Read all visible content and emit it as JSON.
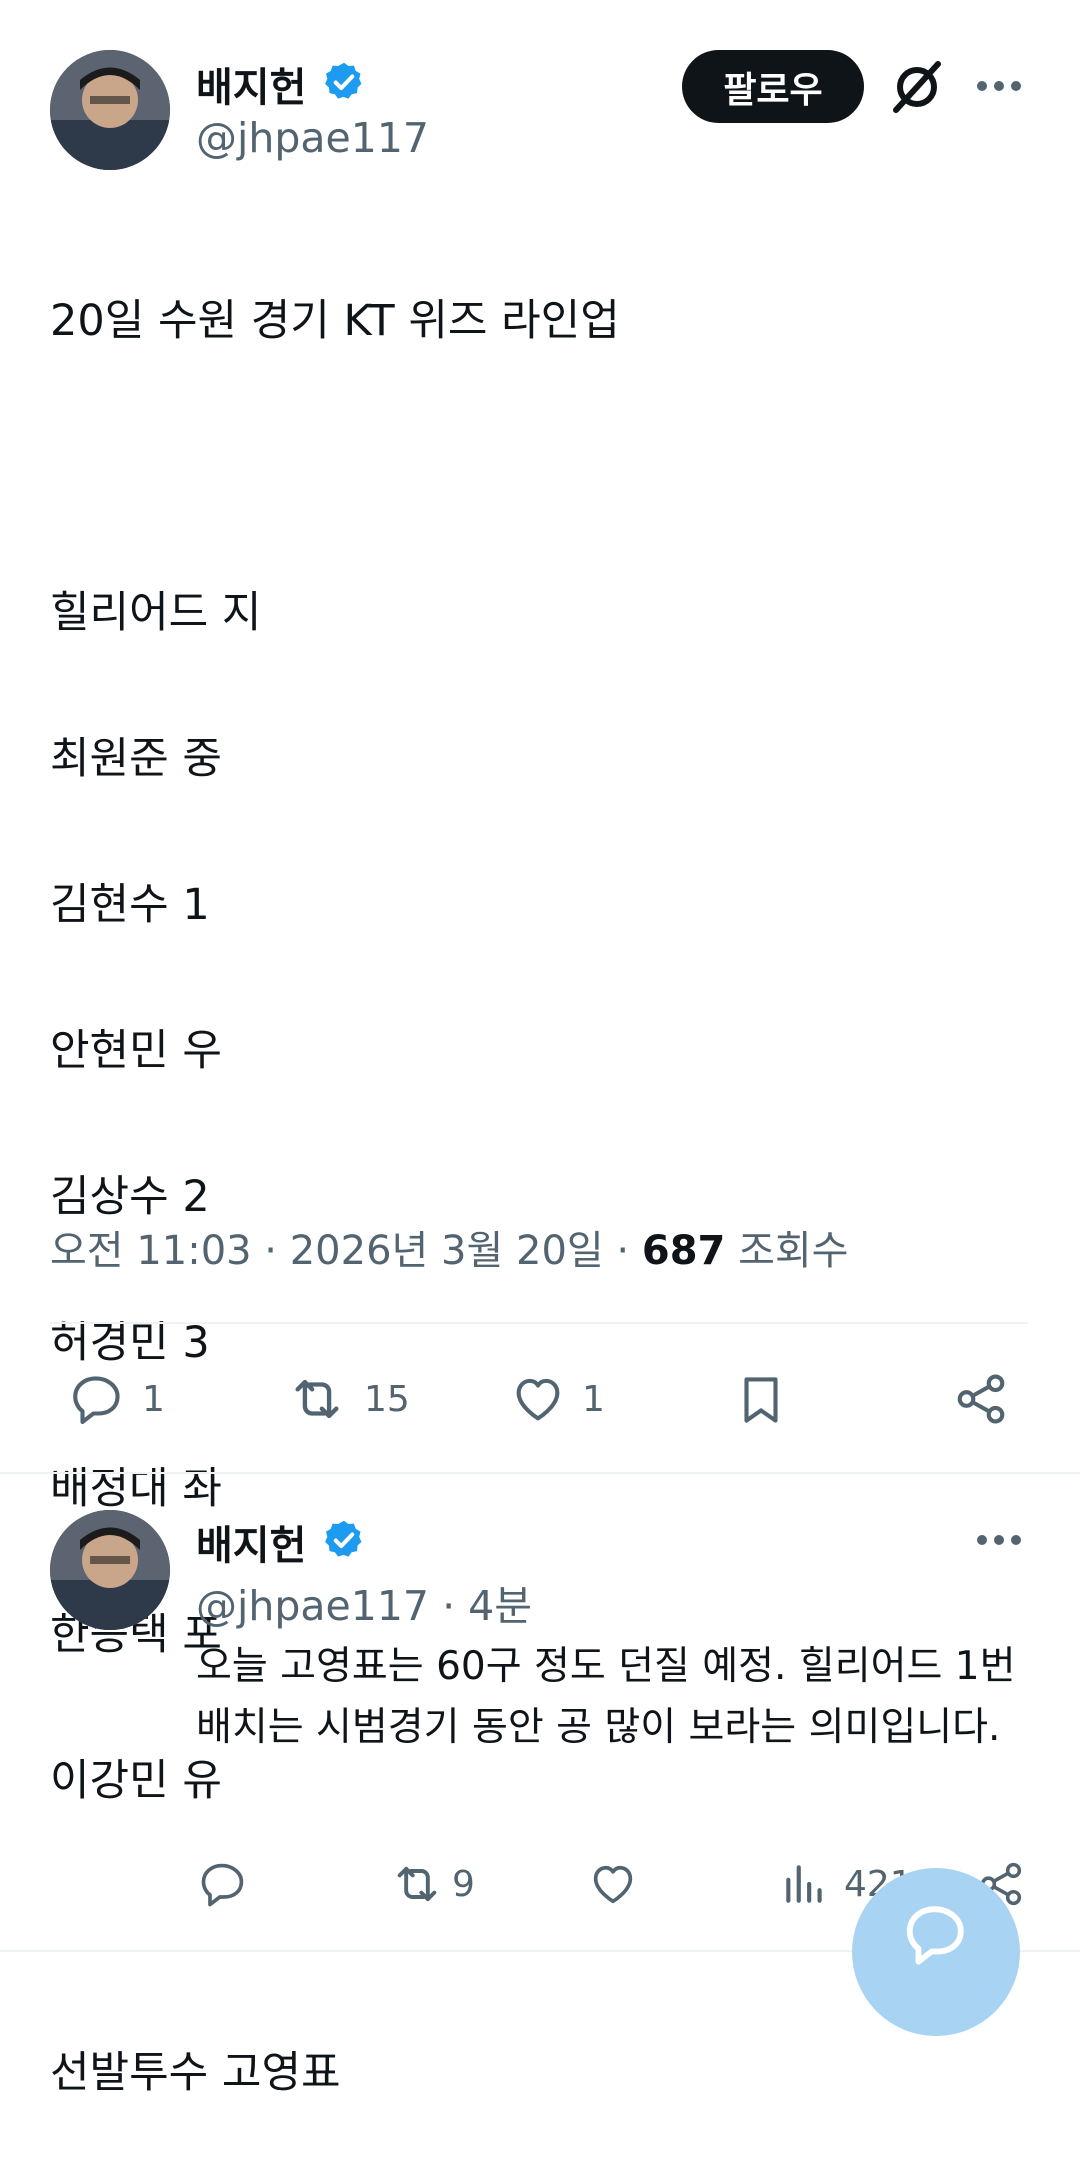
{
  "author": {
    "name": "배지헌",
    "handle": "@jhpae117",
    "verified": true
  },
  "follow_label": "팔로우",
  "tweet": {
    "text_lines": [
      "20일 수원 경기 KT 위즈 라인업",
      "",
      "힐리어드 지",
      "최원준 중",
      "김현수 1",
      "안현민 우",
      "김상수 2",
      "허경민 3",
      "배정대 좌",
      "한승택 포",
      "이강민 유",
      "",
      "선발투수 고영표"
    ],
    "time": "오전 11:03 · 2026년 3월 20일 ·",
    "views_count": "687",
    "views_label": "조회수",
    "replies": "1",
    "retweets": "15",
    "likes": "1"
  },
  "reply": {
    "name": "배지헌",
    "handle": "@jhpae117",
    "time": "· 4분",
    "text": "오늘 고영표는 60구 정도 던질 예정. 힐리어드 1번 배치는 시범경기 동안 공 많이 보라는 의미입니다.",
    "replies": "",
    "retweets": "9",
    "likes": "",
    "views": "421"
  },
  "colors": {
    "verified": "#1d9bf0",
    "muted": "#536471",
    "fab": "#a8d3f2"
  }
}
